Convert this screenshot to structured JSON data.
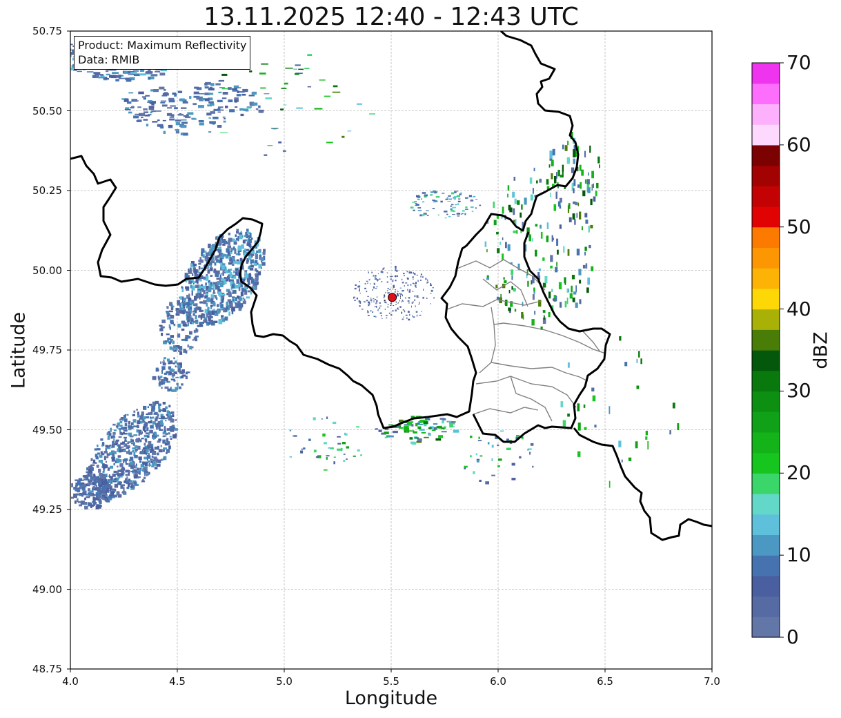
{
  "title": "13.11.2025 12:40 - 12:43 UTC",
  "xlabel": "Longitude",
  "ylabel": "Latitude",
  "info": {
    "product": "Product: Maximum Reflectivity",
    "source": "Data: RMIB"
  },
  "x_ticks": [
    "4.0",
    "4.5",
    "5.0",
    "5.5",
    "6.0",
    "6.5",
    "7.0"
  ],
  "y_ticks": [
    "50.75",
    "50.50",
    "50.25",
    "50.00",
    "49.75",
    "49.50",
    "49.25",
    "49.00",
    "48.75"
  ],
  "extent": {
    "lon": [
      4.0,
      7.0
    ],
    "lat": [
      48.75,
      50.75
    ]
  },
  "radar_site": {
    "lon": 5.505,
    "lat": 49.915,
    "color": "#e0101a"
  },
  "colorbar": {
    "label": "dBZ",
    "ticks": [
      "0",
      "10",
      "20",
      "30",
      "40",
      "50",
      "60",
      "70"
    ],
    "range": [
      0,
      70
    ],
    "colors": [
      "#6376a8",
      "#566aa3",
      "#4a5f9f",
      "#4673b0",
      "#4b99c2",
      "#5ec0da",
      "#63d8c8",
      "#3ad66a",
      "#16c51e",
      "#15b31a",
      "#10a118",
      "#0d8f12",
      "#09790e",
      "#03580b",
      "#4a7c08",
      "#aab106",
      "#fdd806",
      "#fdb306",
      "#fd9603",
      "#fd7a01",
      "#e10303",
      "#c30303",
      "#a20202",
      "#7c0101",
      "#fdd9fd",
      "#fdb1fd",
      "#fd6efd",
      "#ef34ef"
    ]
  },
  "map_data": {
    "type": "radar-reflectivity-map",
    "features": [
      "national borders",
      "subdivision borders",
      "lat/lon grid"
    ],
    "echo_regions": [
      {
        "lon": [
          4.0,
          4.9
        ],
        "lat": [
          50.5,
          50.75
        ],
        "dbz": "0-15"
      },
      {
        "lon": [
          4.4,
          4.9
        ],
        "lat": [
          49.75,
          50.15
        ],
        "dbz": "0-15"
      },
      {
        "lon": [
          4.0,
          4.55
        ],
        "lat": [
          49.25,
          49.65
        ],
        "dbz": "0-15"
      },
      {
        "lon": [
          5.8,
          6.5
        ],
        "lat": [
          49.4,
          50.4
        ],
        "dbz": "10-40"
      }
    ]
  }
}
